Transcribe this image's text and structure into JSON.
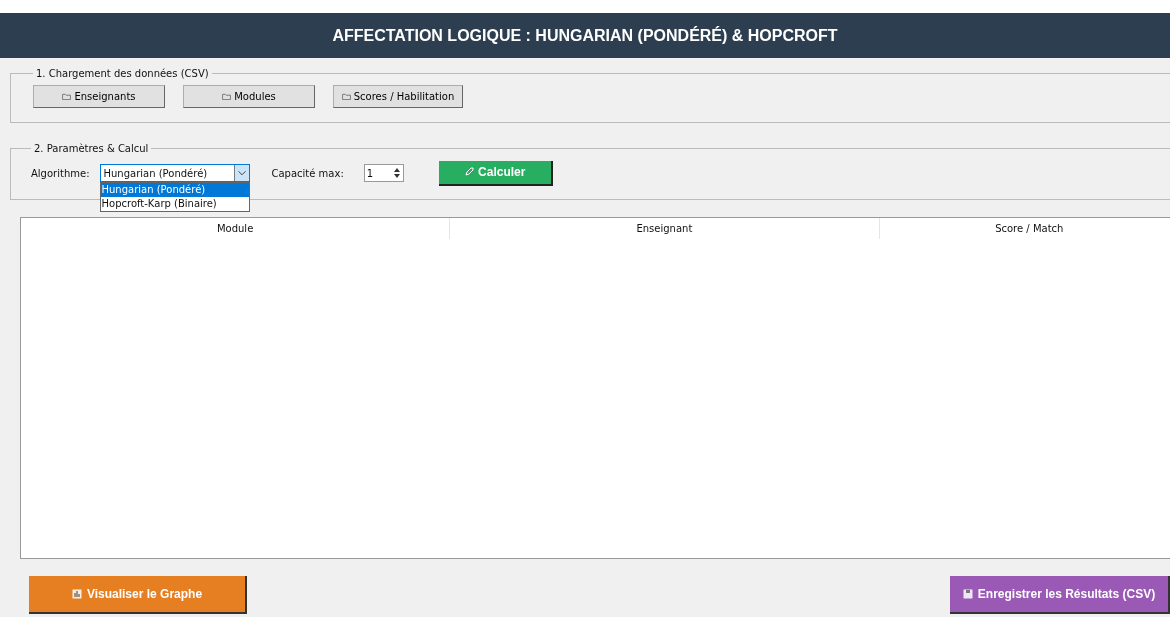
{
  "header": {
    "title": "AFFECTATION LOGIQUE : HUNGARIAN (PONDÉRÉ) & HOPCROFT"
  },
  "loading": {
    "title": "1. Chargement des données (CSV)",
    "buttons": [
      "Enseignants",
      "Modules",
      "Scores / Habilitation"
    ]
  },
  "params": {
    "title": "2. Paramètres & Calcul",
    "algorithm_label": "Algorithme:",
    "algorithm_value": "Hungarian (Pondéré)",
    "expanded": true,
    "options": [
      {
        "label": "Hungarian (Pondéré)",
        "selected": true
      },
      {
        "label": "Hopcroft-Karp (Binaire)",
        "selected": false
      }
    ],
    "capacity_label": "Capacité max:",
    "capacity_value": "1",
    "calculate": "Calculer"
  },
  "table": {
    "columns": [
      "Module",
      "Enseignant",
      "Score / Match"
    ]
  },
  "actions": [
    {
      "label": "Visualiser le Graphe",
      "kind": "graph"
    },
    {
      "label": "Enregistrer les Résultats (CSV)",
      "kind": "save"
    }
  ]
}
